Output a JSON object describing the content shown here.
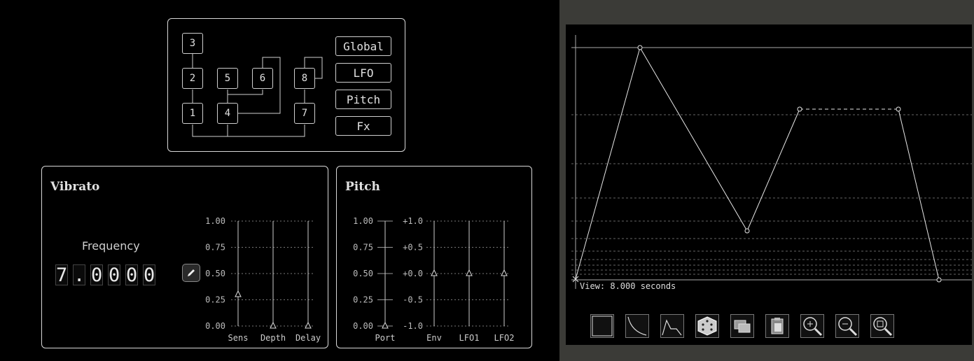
{
  "algorithm": {
    "operators": [
      "1",
      "2",
      "3",
      "4",
      "5",
      "6",
      "7",
      "8"
    ],
    "buttons": {
      "global": "Global",
      "lfo": "LFO",
      "pitch": "Pitch",
      "fx": "Fx"
    }
  },
  "vibrato": {
    "title": "Vibrato",
    "frequency_label": "Frequency",
    "frequency_digits": [
      "7",
      ".",
      "0",
      "0",
      "0",
      "0"
    ],
    "y_ticks": [
      "1.00",
      "0.75",
      "0.50",
      "0.25",
      "0.00"
    ],
    "sliders": [
      {
        "label": "Sens",
        "value": 0.3
      },
      {
        "label": "Depth",
        "value": 0.0
      },
      {
        "label": "Delay",
        "value": 0.0
      }
    ]
  },
  "pitch": {
    "title": "Pitch",
    "left_ticks": [
      "1.00",
      "0.75",
      "0.50",
      "0.25",
      "0.00"
    ],
    "right_ticks": [
      "+1.0",
      "+0.5",
      "+0.0",
      "-0.5",
      "-1.0"
    ],
    "sliders": [
      {
        "label": "Port",
        "value": 0.0
      },
      {
        "label": "Env",
        "value": 0.0
      },
      {
        "label": "LFO1",
        "value": 0.0
      },
      {
        "label": "LFO2",
        "value": 0.0
      }
    ]
  },
  "envelope": {
    "view_label": "View:  8.000 seconds",
    "tools": [
      "square-shape-icon",
      "decay-curve-icon",
      "peak-shape-icon",
      "dice-icon",
      "copy-icon",
      "paste-icon",
      "zoom-in-icon",
      "zoom-out-icon",
      "zoom-fit-icon"
    ]
  },
  "colors": {
    "line": "#e6e6e6",
    "background": "#000000",
    "frame": "#3b3b37"
  }
}
